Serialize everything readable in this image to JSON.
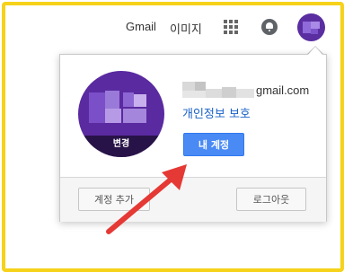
{
  "header": {
    "gmail_label": "Gmail",
    "images_label": "이미지",
    "apps_icon": "apps-grid-icon",
    "notifications_icon": "bell-icon"
  },
  "account_popup": {
    "avatar_change_label": "변경",
    "email_suffix": "gmail.com",
    "privacy_link": "개인정보 보호",
    "my_account_button": "내 계정",
    "add_account_button": "계정 추가",
    "logout_button": "로그아웃"
  },
  "colors": {
    "highlight_frame": "#f6d21a",
    "primary_button": "#4a8af4",
    "link": "#1a62c8",
    "annotation_arrow": "#e53935",
    "avatar_purple": "#5a2aa0"
  }
}
